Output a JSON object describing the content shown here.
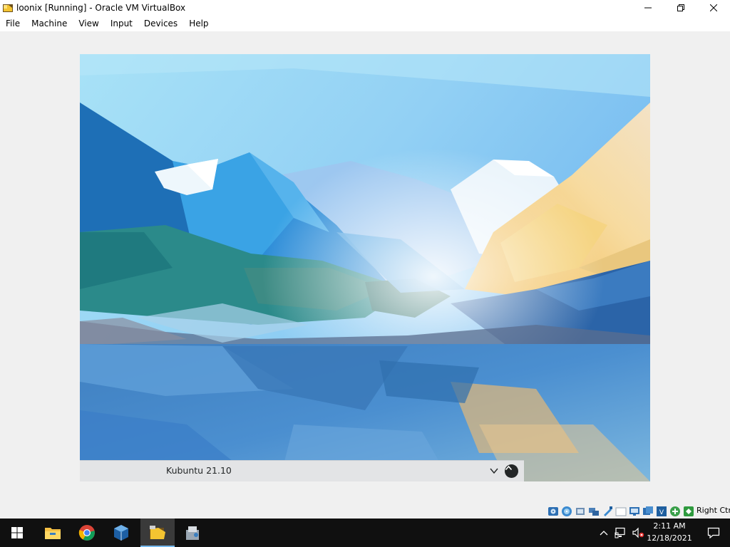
{
  "window": {
    "title": "loonix [Running] - Oracle VM VirtualBox",
    "minimize_glyph": "—",
    "restore_glyph": "❐",
    "close_glyph": "✕"
  },
  "menu": [
    "File",
    "Machine",
    "View",
    "Input",
    "Devices",
    "Help"
  ],
  "vm": {
    "session_name": "Kubuntu 21.10"
  },
  "statusbar": {
    "icons": [
      "hard-disk-icon",
      "optical-drive-icon",
      "audio-icon",
      "network-icon",
      "usb-icon",
      "shared-folders-icon",
      "display-icon",
      "video-capture-icon",
      "vt-x-icon",
      "mouse-integration-icon",
      "keyboard-capture-icon"
    ],
    "host_key": "Right Ctrl"
  },
  "taskbar": {
    "apps": [
      "file-explorer",
      "google-chrome",
      "virtualbox",
      "virtualbox-vm",
      "app-installer"
    ],
    "active_app": "virtualbox-vm"
  },
  "tray": {
    "time": "2:11 AM",
    "date": "12/18/2021"
  },
  "colors": {
    "taskbar": "#101010",
    "accent": "#76b9ed",
    "login_bar": "#e3e4e6"
  }
}
